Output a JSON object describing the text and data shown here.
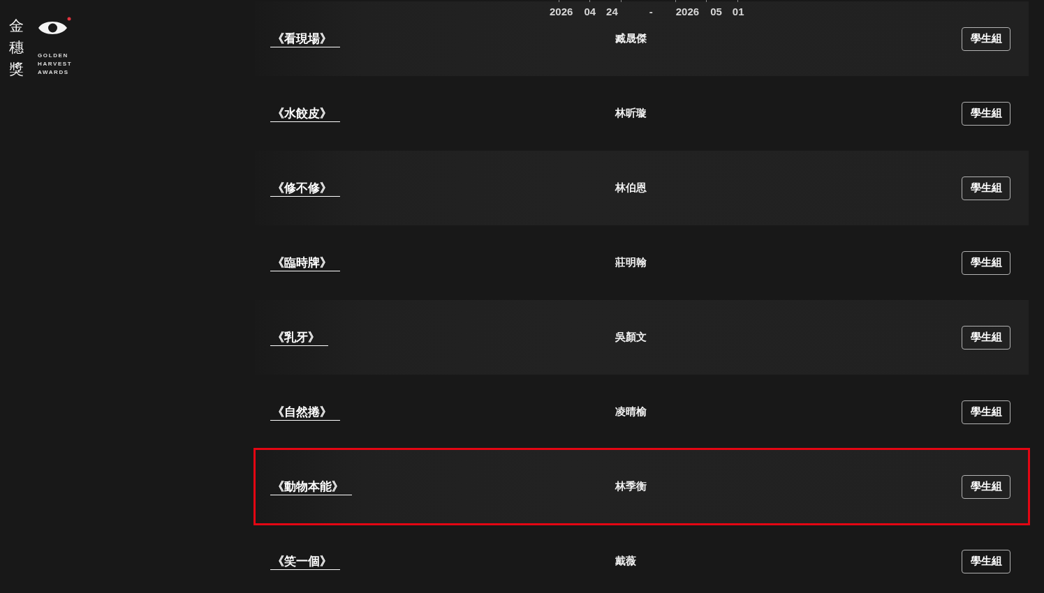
{
  "logo": {
    "chinese": "金穗獎",
    "english": "GOLDEN HARVEST AWARDS"
  },
  "date_range": {
    "start": [
      "2026",
      "04",
      "24"
    ],
    "separator": "-",
    "end": [
      "2026",
      "05",
      "01"
    ]
  },
  "films": [
    {
      "title": "《看現場》",
      "director": "臧晟傑",
      "category": "學生組",
      "highlighted": false
    },
    {
      "title": "《水餃皮》",
      "director": "林昕璇",
      "category": "學生組",
      "highlighted": false
    },
    {
      "title": "《修不修》",
      "director": "林伯恩",
      "category": "學生組",
      "highlighted": false
    },
    {
      "title": "《臨時牌》",
      "director": "莊明翰",
      "category": "學生組",
      "highlighted": false
    },
    {
      "title": "《乳牙》",
      "director": "吳顏文",
      "category": "學生組",
      "highlighted": false
    },
    {
      "title": "《自然捲》",
      "director": "凌晴榆",
      "category": "學生組",
      "highlighted": false
    },
    {
      "title": "《動物本能》",
      "director": "林季衡",
      "category": "學生組",
      "highlighted": true
    },
    {
      "title": "《笑一個》",
      "director": "戴薇",
      "category": "學生組",
      "highlighted": false
    }
  ]
}
